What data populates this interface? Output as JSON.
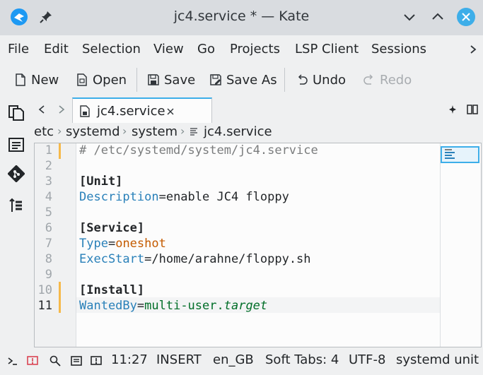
{
  "window": {
    "title": "jc4.service * — Kate"
  },
  "menu": [
    "File",
    "Edit",
    "Selection",
    "View",
    "Go",
    "Projects",
    "LSP Client",
    "Sessions"
  ],
  "toolbar": {
    "new": "New",
    "open": "Open",
    "save": "Save",
    "save_as": "Save As",
    "undo": "Undo",
    "redo": "Redo"
  },
  "tab": {
    "label": "jc4.service"
  },
  "breadcrumb": [
    "etc",
    "systemd",
    "system",
    "jc4.service"
  ],
  "editor": {
    "current_line": 11,
    "lines": [
      {
        "n": "1",
        "parts": [
          {
            "t": "# /etc/systemd/system/jc4.service",
            "c": "#7a7c7d"
          }
        ]
      },
      {
        "n": "2",
        "parts": []
      },
      {
        "n": "3",
        "parts": [
          {
            "t": "[Unit]",
            "c": "#232629",
            "b": true
          }
        ]
      },
      {
        "n": "4",
        "parts": [
          {
            "t": "Description",
            "c": "#2980b9"
          },
          {
            "t": "=enable JC4 floppy",
            "c": "#232629"
          }
        ]
      },
      {
        "n": "5",
        "parts": []
      },
      {
        "n": "6",
        "parts": [
          {
            "t": "[Service]",
            "c": "#232629",
            "b": true
          }
        ]
      },
      {
        "n": "7",
        "parts": [
          {
            "t": "Type",
            "c": "#2980b9"
          },
          {
            "t": "=",
            "c": "#232629"
          },
          {
            "t": "oneshot",
            "c": "#c45b00"
          }
        ]
      },
      {
        "n": "8",
        "parts": [
          {
            "t": "ExecStart",
            "c": "#2980b9"
          },
          {
            "t": "=/home/arahne/floppy.sh",
            "c": "#232629"
          }
        ]
      },
      {
        "n": "9",
        "parts": []
      },
      {
        "n": "10",
        "parts": [
          {
            "t": "[Install]",
            "c": "#232629",
            "b": true
          }
        ]
      },
      {
        "n": "11",
        "parts": [
          {
            "t": "WantedBy",
            "c": "#2980b9"
          },
          {
            "t": "=",
            "c": "#232629"
          },
          {
            "t": "multi-user.",
            "c": "#006e28"
          },
          {
            "t": "target",
            "c": "#006e28",
            "i": true
          }
        ]
      }
    ]
  },
  "status": {
    "position": "11:27",
    "mode": "INSERT",
    "dictionary": "en_GB",
    "indent": "Soft Tabs: 4",
    "encoding": "UTF-8",
    "syntax": "systemd unit"
  },
  "colors": {
    "accent": "#3daee9",
    "modified": "#f6b94a"
  }
}
